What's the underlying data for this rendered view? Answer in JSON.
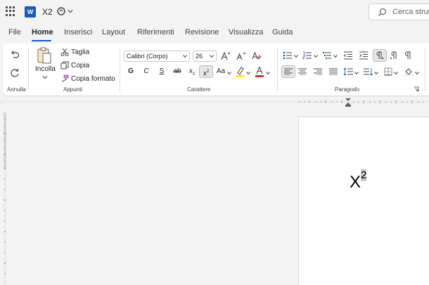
{
  "app": {
    "doc_title": "X2"
  },
  "search": {
    "placeholder": "Cerca strum"
  },
  "menu": {
    "tabs": [
      {
        "label": "File"
      },
      {
        "label": "Home",
        "active": true
      },
      {
        "label": "Inserisci"
      },
      {
        "label": "Layout"
      },
      {
        "label": "Riferimenti"
      },
      {
        "label": "Revisione"
      },
      {
        "label": "Visualizza"
      },
      {
        "label": "Guida"
      }
    ]
  },
  "ribbon": {
    "annulla": {
      "label": "Annulla"
    },
    "appunti": {
      "label": "Appunti",
      "paste_label": "Incolla",
      "cut_label": "Taglia",
      "copy_label": "Copia",
      "format_painter_label": "Copia formato"
    },
    "carattere": {
      "label": "Carattere",
      "font_name": "Calibri (Corpo)",
      "font_size": "26",
      "bold": "G",
      "italic": "C",
      "underline": "S",
      "strikethrough": "ab",
      "subscript": "x",
      "superscript": "x",
      "change_case": "Aa",
      "superscript_pressed": true
    },
    "paragrafo": {
      "label": "Paragrafo"
    }
  },
  "colors": {
    "accent": "#185abd",
    "highlight": "#ffee00",
    "font_color": "#d13438"
  },
  "document": {
    "base": "X",
    "superscript": "2"
  }
}
